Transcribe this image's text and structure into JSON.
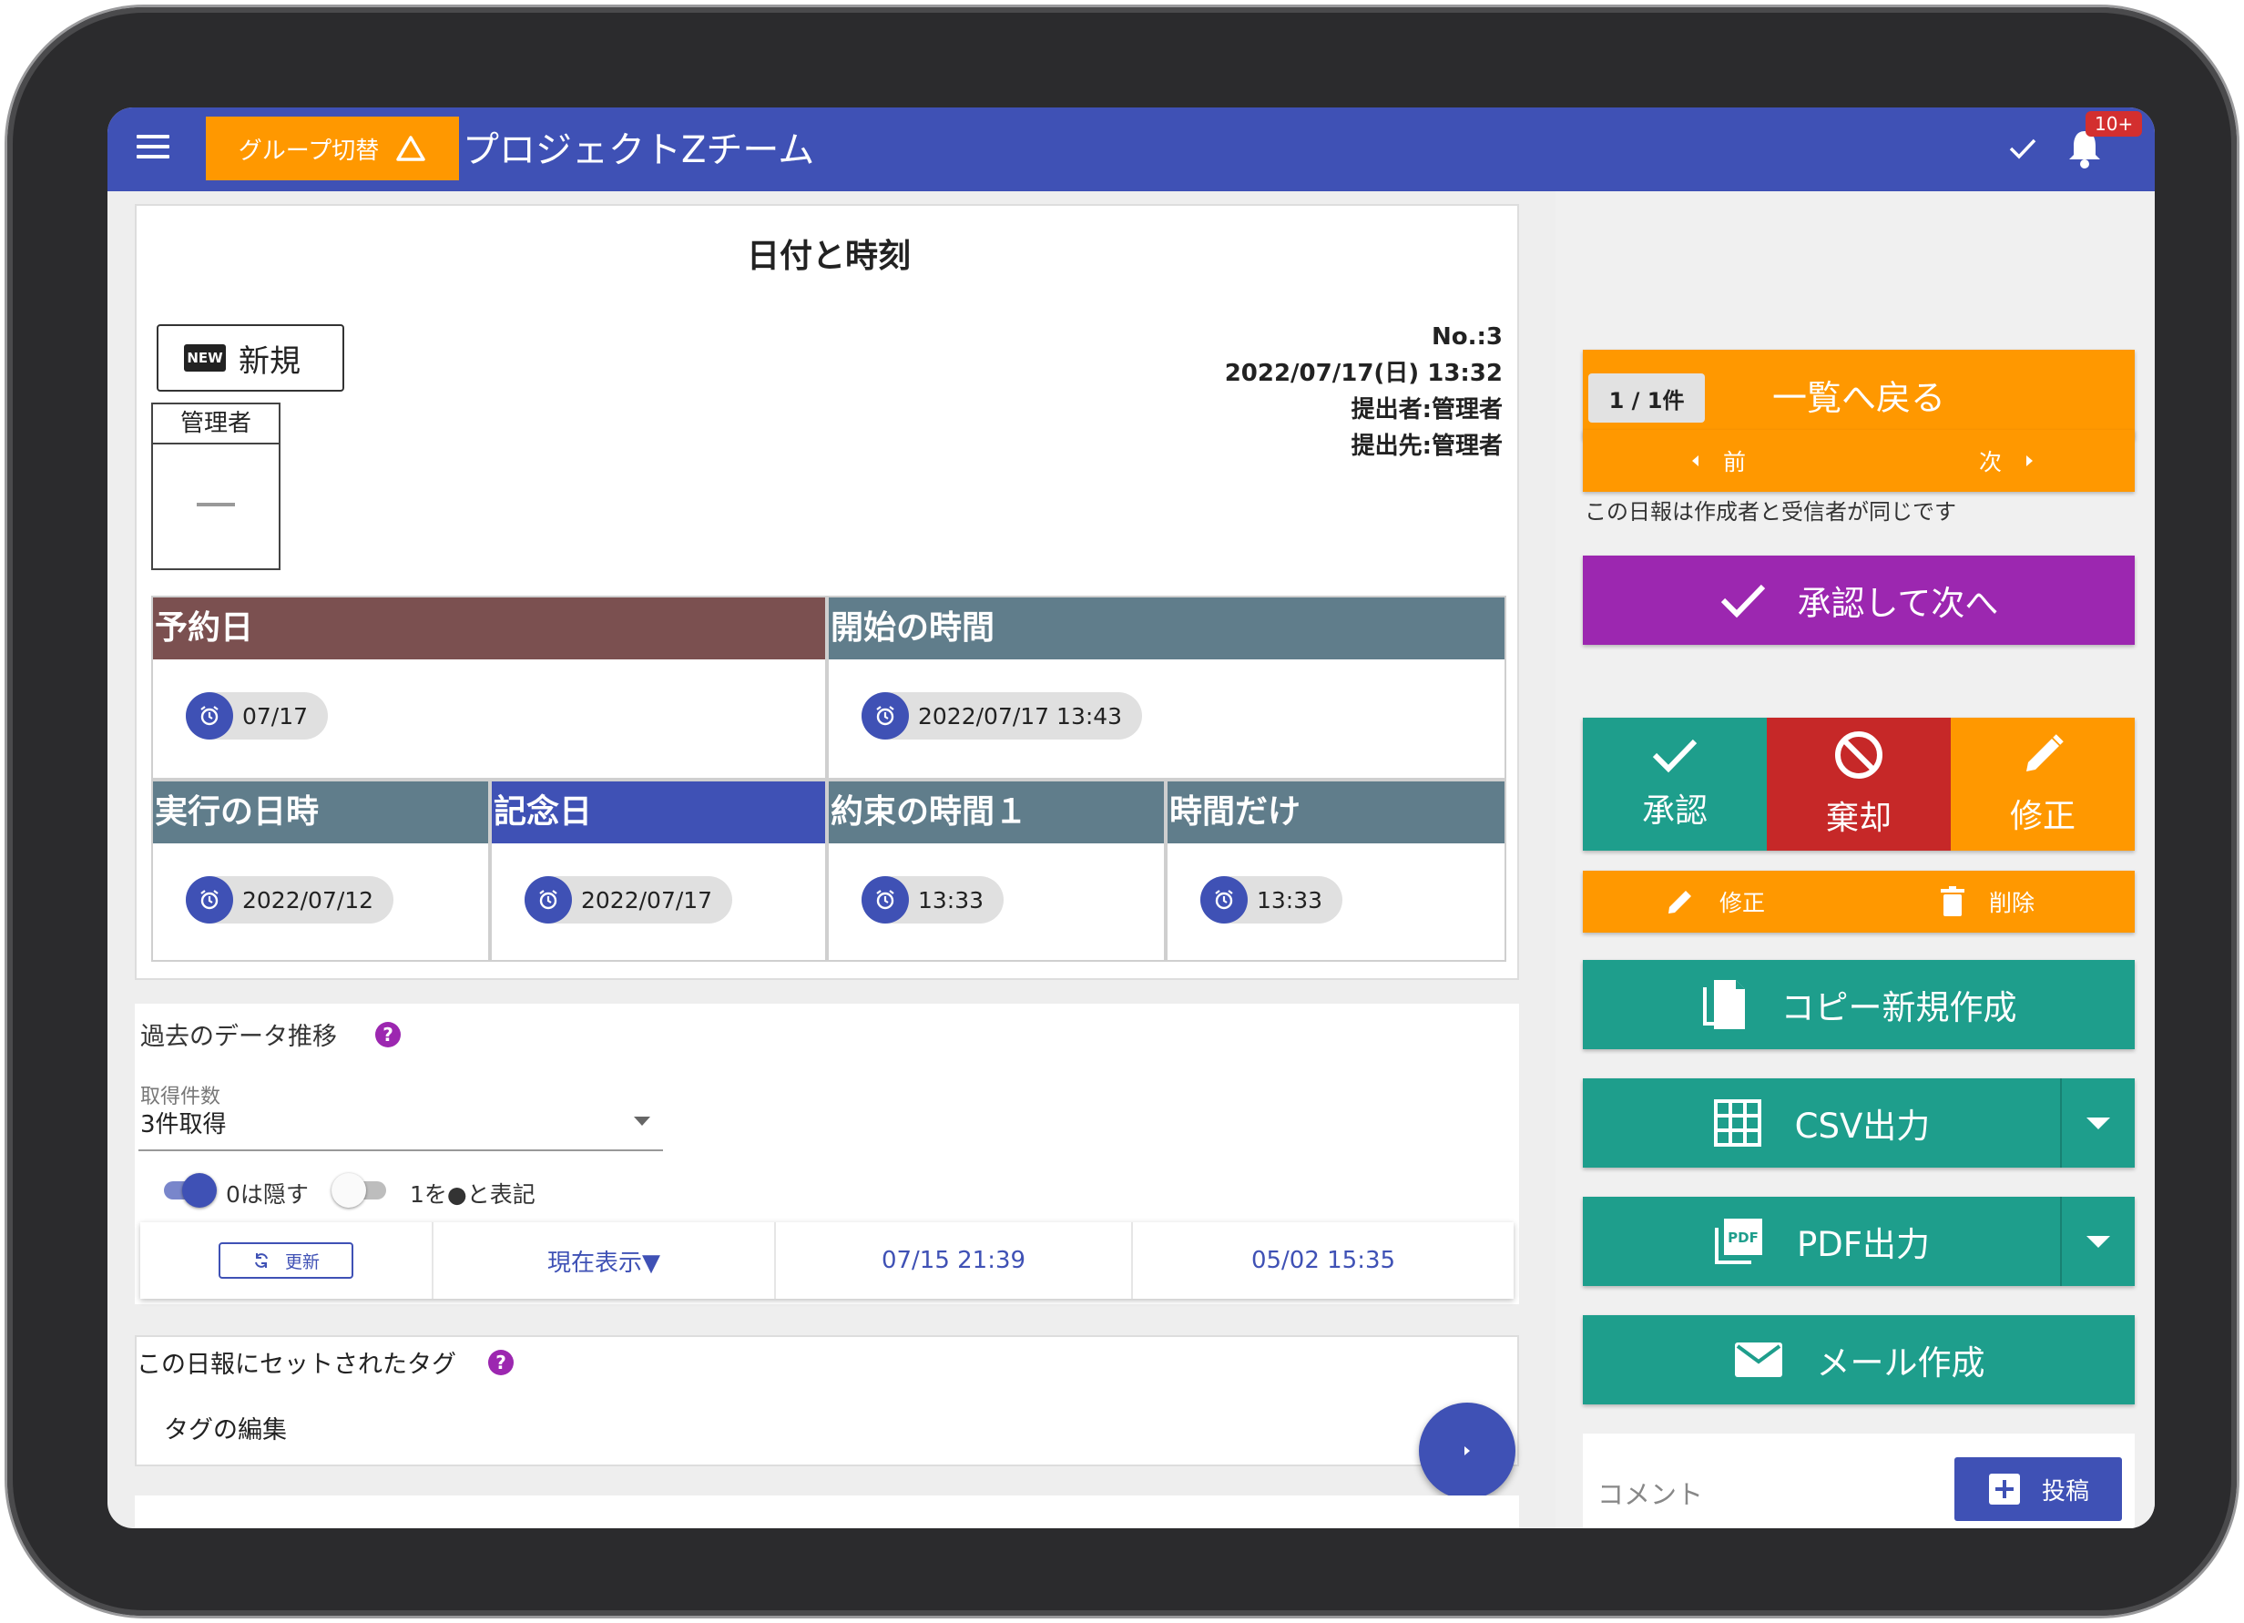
{
  "header": {
    "group_switch_label": "グループ切替",
    "app_title": "プロジェクトZチーム",
    "notification_count": "10+"
  },
  "report": {
    "title": "日付と時刻",
    "status_tag": "新規",
    "status_icon_text": "NEW",
    "approver_label": "管理者",
    "approver_stamp": "—",
    "number": "No.:3",
    "datetime": "2022/07/17(日) 13:32",
    "submitter": "提出者:管理者",
    "recipient": "提出先:管理者",
    "fields": [
      {
        "label": "予約日",
        "value": "07/17",
        "color": "#7b5050"
      },
      {
        "label": "開始の時間",
        "value": "2022/07/17 13:43",
        "color": "#607d8b"
      },
      {
        "label": "実行の日時",
        "value": "2022/07/12",
        "color": "#607d8b"
      },
      {
        "label": "記念日",
        "value": "2022/07/17",
        "color": "#3f51b5"
      },
      {
        "label": "約束の時間１",
        "value": "13:33",
        "color": "#607d8b"
      },
      {
        "label": "時間だけ",
        "value": "13:33",
        "color": "#607d8b"
      }
    ]
  },
  "history": {
    "title": "過去のデータ推移",
    "help": "?",
    "select_label": "取得件数",
    "select_value": "3件取得",
    "toggle_hide_zero": {
      "label": "0は隠す",
      "on": true
    },
    "toggle_dot": {
      "label": "1を●と表記",
      "on": false
    },
    "refresh_label": "更新",
    "columns": [
      "現在表示▼",
      "07/15 21:39",
      "05/02 15:35"
    ]
  },
  "tags": {
    "title": "この日報にセットされたタグ",
    "help": "?",
    "edit_label": "タグの編集"
  },
  "sidebar": {
    "back_label": "一覧へ戻る",
    "page_count": "1 / 1件",
    "prev_label": "前",
    "next_label": "次",
    "notice": "この日報は作成者と受信者が同じです",
    "approve_next_label": "承認して次へ",
    "approve_label": "承認",
    "reject_label": "棄却",
    "revise_label": "修正",
    "edit_label": "修正",
    "delete_label": "削除",
    "copy_label": "コピー新規作成",
    "csv_label": "CSV出力",
    "pdf_label": "PDF出力",
    "pdf_icon_text": "PDF",
    "mail_label": "メール作成",
    "comment_label": "コメント",
    "post_label": "投稿"
  },
  "colors": {
    "primary": "#3f51b5",
    "orange": "#ff9800",
    "teal": "#1e9e8c",
    "purple": "#9c27b0",
    "reject_red": "#c62828"
  }
}
